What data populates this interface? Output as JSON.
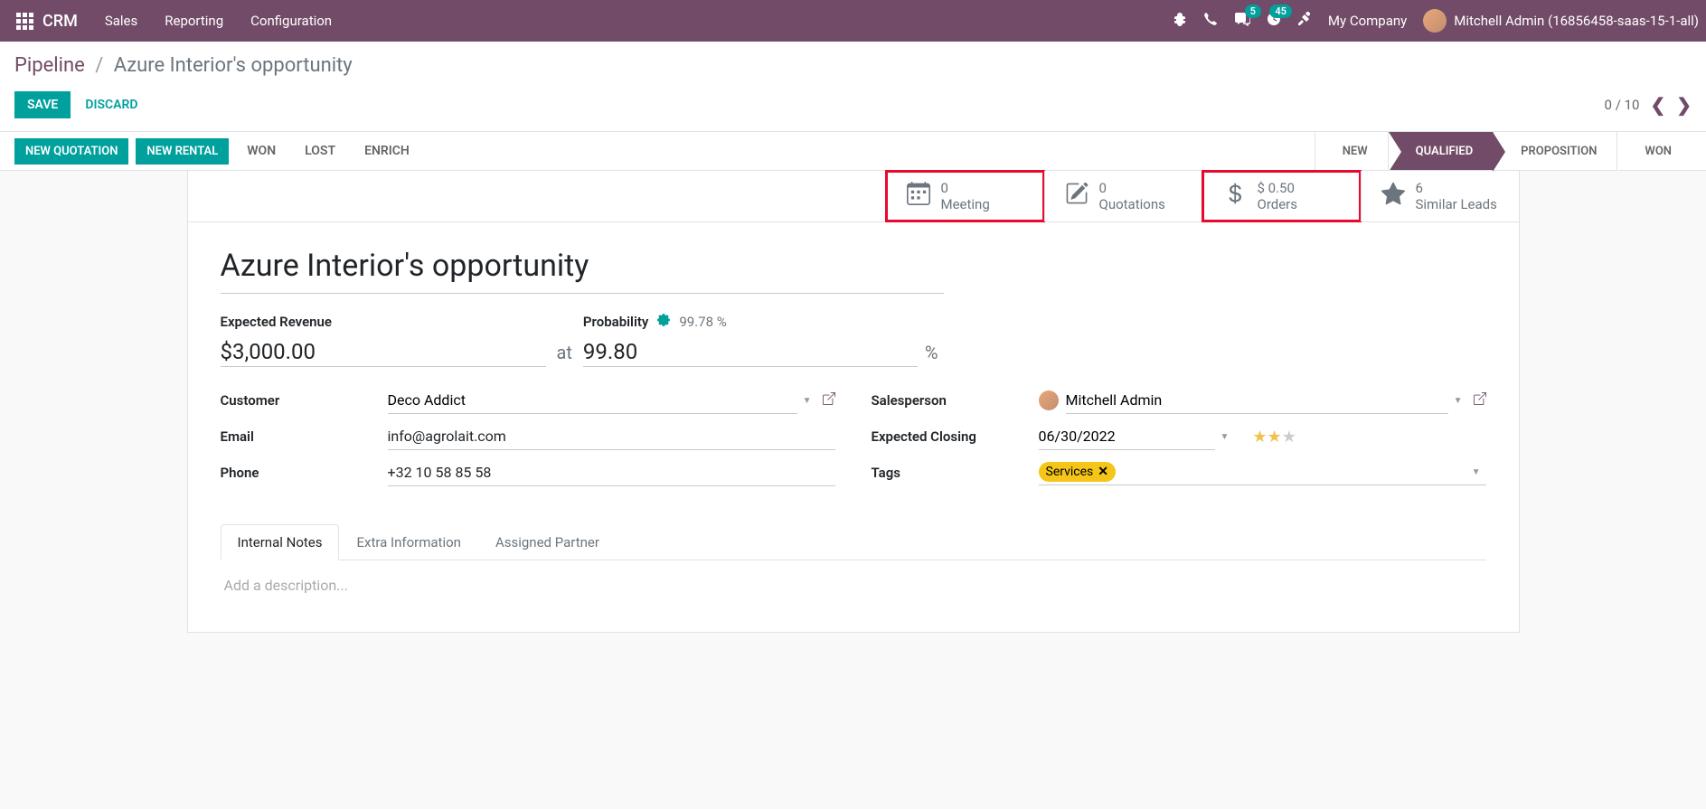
{
  "navbar": {
    "brand": "CRM",
    "menu": [
      "Sales",
      "Reporting",
      "Configuration"
    ],
    "messaging_badge": "5",
    "activities_badge": "45",
    "company": "My Company",
    "user": "Mitchell Admin (16856458-saas-15-1-all)"
  },
  "breadcrumb": {
    "root": "Pipeline",
    "current": "Azure Interior's opportunity"
  },
  "controls": {
    "save": "SAVE",
    "discard": "DISCARD",
    "pager": "0 / 10"
  },
  "actions": {
    "new_quotation": "NEW QUOTATION",
    "new_rental": "NEW RENTAL",
    "won": "WON",
    "lost": "LOST",
    "enrich": "ENRICH"
  },
  "stages": [
    "NEW",
    "QUALIFIED",
    "PROPOSITION",
    "WON"
  ],
  "active_stage": "QUALIFIED",
  "stats": {
    "meeting": {
      "value": "0",
      "label": "Meeting"
    },
    "quotations": {
      "value": "0",
      "label": "Quotations"
    },
    "orders": {
      "value": "$ 0.50",
      "label": "Orders"
    },
    "similar": {
      "value": "6",
      "label": "Similar Leads"
    }
  },
  "record": {
    "name": "Azure Interior's opportunity",
    "expected_revenue_label": "Expected Revenue",
    "expected_revenue": "$3,000.00",
    "at": "at",
    "probability_label": "Probability",
    "probability": "99.80",
    "auto_probability": "99.78 %",
    "pct": "%",
    "customer_label": "Customer",
    "customer": "Deco Addict",
    "email_label": "Email",
    "email": "info@agrolait.com",
    "phone_label": "Phone",
    "phone": "+32 10 58 85 58",
    "salesperson_label": "Salesperson",
    "salesperson": "Mitchell Admin",
    "expected_closing_label": "Expected Closing",
    "expected_closing": "06/30/2022",
    "priority": 2,
    "tags_label": "Tags",
    "tags": [
      "Services"
    ]
  },
  "tabs": {
    "items": [
      "Internal Notes",
      "Extra Information",
      "Assigned Partner"
    ],
    "active": "Internal Notes",
    "description_placeholder": "Add a description..."
  }
}
